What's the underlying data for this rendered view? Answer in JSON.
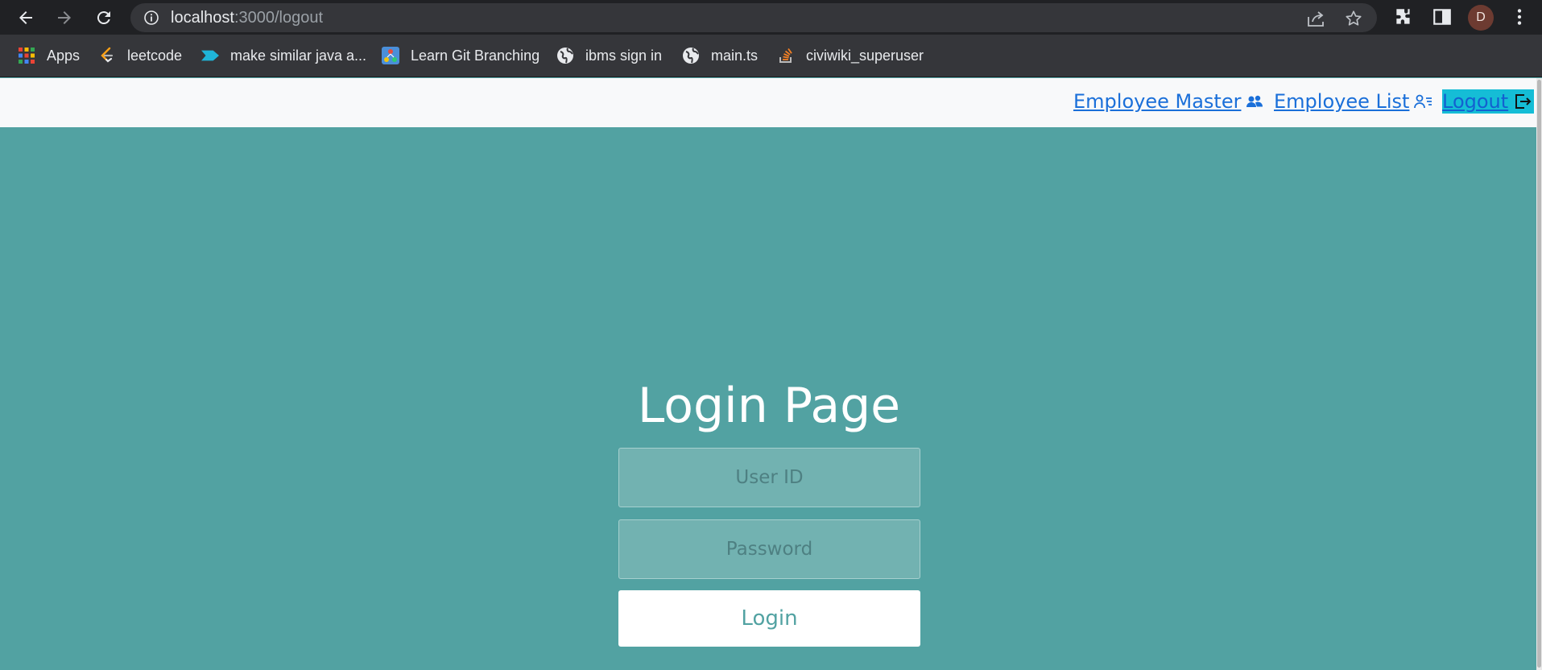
{
  "browser": {
    "url_host": "localhost",
    "url_path": ":3000/logout",
    "profile_initial": "D",
    "bookmarks": [
      {
        "label": "Apps",
        "icon": "apps-grid-icon"
      },
      {
        "label": "leetcode",
        "icon": "leetcode-icon"
      },
      {
        "label": "make similar java a...",
        "icon": "chevron-tag-icon"
      },
      {
        "label": "Learn Git Branching",
        "icon": "git-branch-icon"
      },
      {
        "label": "ibms sign in",
        "icon": "globe-icon"
      },
      {
        "label": "main.ts",
        "icon": "globe-icon"
      },
      {
        "label": "civiwiki_superuser",
        "icon": "stackoverflow-icon"
      }
    ]
  },
  "navbar": {
    "employee_master": "Employee Master",
    "employee_list": "Employee List",
    "logout": "Logout"
  },
  "login": {
    "title": "Login Page",
    "user_id_placeholder": "User ID",
    "password_placeholder": "Password",
    "button_label": "Login"
  },
  "colors": {
    "page_background": "#52a2a2",
    "navbar_background": "#f8f9fa",
    "link": "#1a6fd9",
    "logout_highlight": "#15bdd6",
    "browser_frame": "#202124",
    "bookmark_bar": "#35363a"
  }
}
